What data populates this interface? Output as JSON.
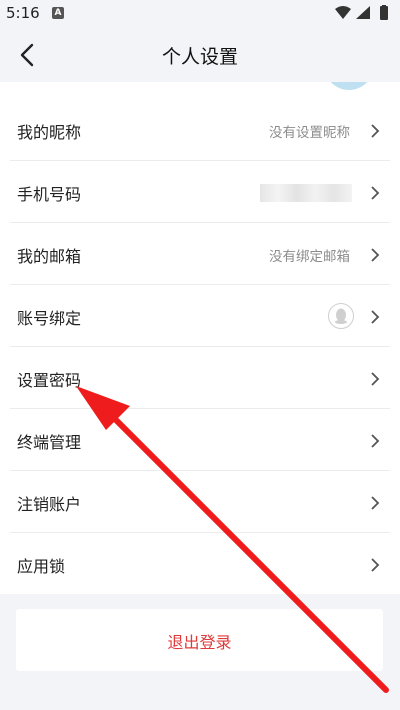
{
  "status_bar": {
    "time": "5:16",
    "notif_badge": "A"
  },
  "header": {
    "title": "个人设置"
  },
  "rows": [
    {
      "label": "我的昵称",
      "value": "没有设置昵称"
    },
    {
      "label": "手机号码",
      "value": ""
    },
    {
      "label": "我的邮箱",
      "value": "没有绑定邮箱"
    },
    {
      "label": "账号绑定",
      "value": ""
    },
    {
      "label": "设置密码",
      "value": ""
    },
    {
      "label": "终端管理",
      "value": ""
    },
    {
      "label": "注销账户",
      "value": ""
    },
    {
      "label": "应用锁",
      "value": ""
    }
  ],
  "logout": {
    "label": "退出登录"
  },
  "colors": {
    "accent_red": "#e0393b",
    "annotation_arrow": "#ee1c1c",
    "background": "#f3f4f8"
  },
  "icons": [
    "back-arrow-icon",
    "chevron-right-icon",
    "qq-penguin-icon",
    "wifi-icon",
    "signal-icon",
    "battery-icon"
  ]
}
